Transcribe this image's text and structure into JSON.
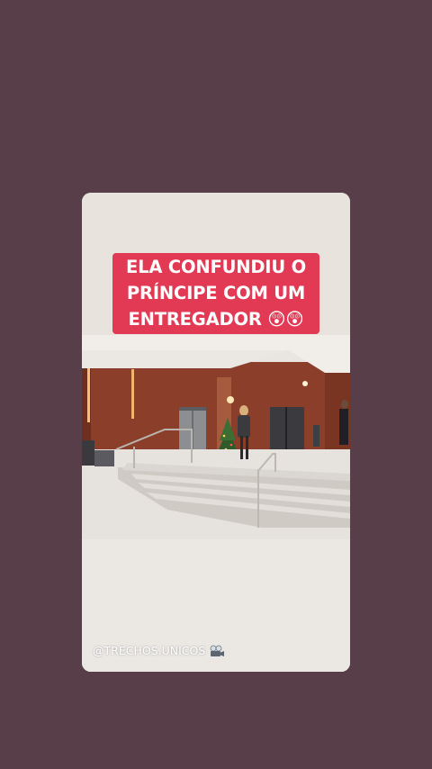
{
  "story": {
    "caption_lines": [
      "ELA CONFUNDIU O",
      "PRÍNCIPE COM UM",
      "ENTREGADOR 😲😲"
    ],
    "handle": "@TRECHOS.UNICOS",
    "handle_icon": "film-camera-icon"
  },
  "colors": {
    "background": "#573e48",
    "caption_bg": "#e23a55",
    "caption_text": "#ffffff"
  }
}
